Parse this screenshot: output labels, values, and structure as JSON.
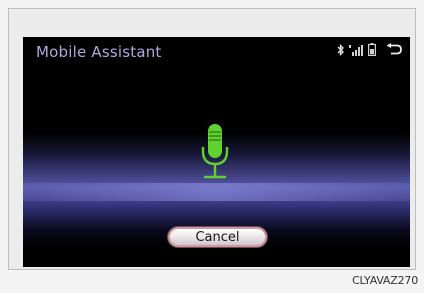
{
  "screen": {
    "title": "Mobile Assistant",
    "status_icons": [
      "bluetooth-icon",
      "signal-strength-icon",
      "battery-icon"
    ],
    "back_icon": "back-arrow-icon",
    "main_icon": "microphone-icon",
    "cancel_label": "Cancel"
  },
  "figure_code": "CLYAVAZ270",
  "colors": {
    "title": "#b3a7de",
    "microphone": "#5fd22f",
    "glow": "#5c5cb2",
    "background": "#000000"
  }
}
